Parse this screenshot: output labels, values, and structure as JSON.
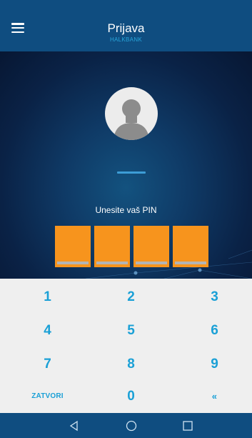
{
  "header": {
    "title": "Prijava",
    "subtitle": "HALKBANK"
  },
  "login": {
    "prompt": "Unesite vaš PIN",
    "pin_length": 4
  },
  "keypad": {
    "keys": [
      "1",
      "2",
      "3",
      "4",
      "5",
      "6",
      "7",
      "8",
      "9",
      "ZATVORI",
      "0",
      "«"
    ]
  },
  "colors": {
    "header_bg": "#0f4d80",
    "accent": "#1aa0d6",
    "pin_box": "#f7941d",
    "keypad_bg": "#efefef"
  },
  "icons": [
    "menu-icon",
    "user-avatar-icon",
    "back-icon",
    "home-icon",
    "recents-icon"
  ]
}
